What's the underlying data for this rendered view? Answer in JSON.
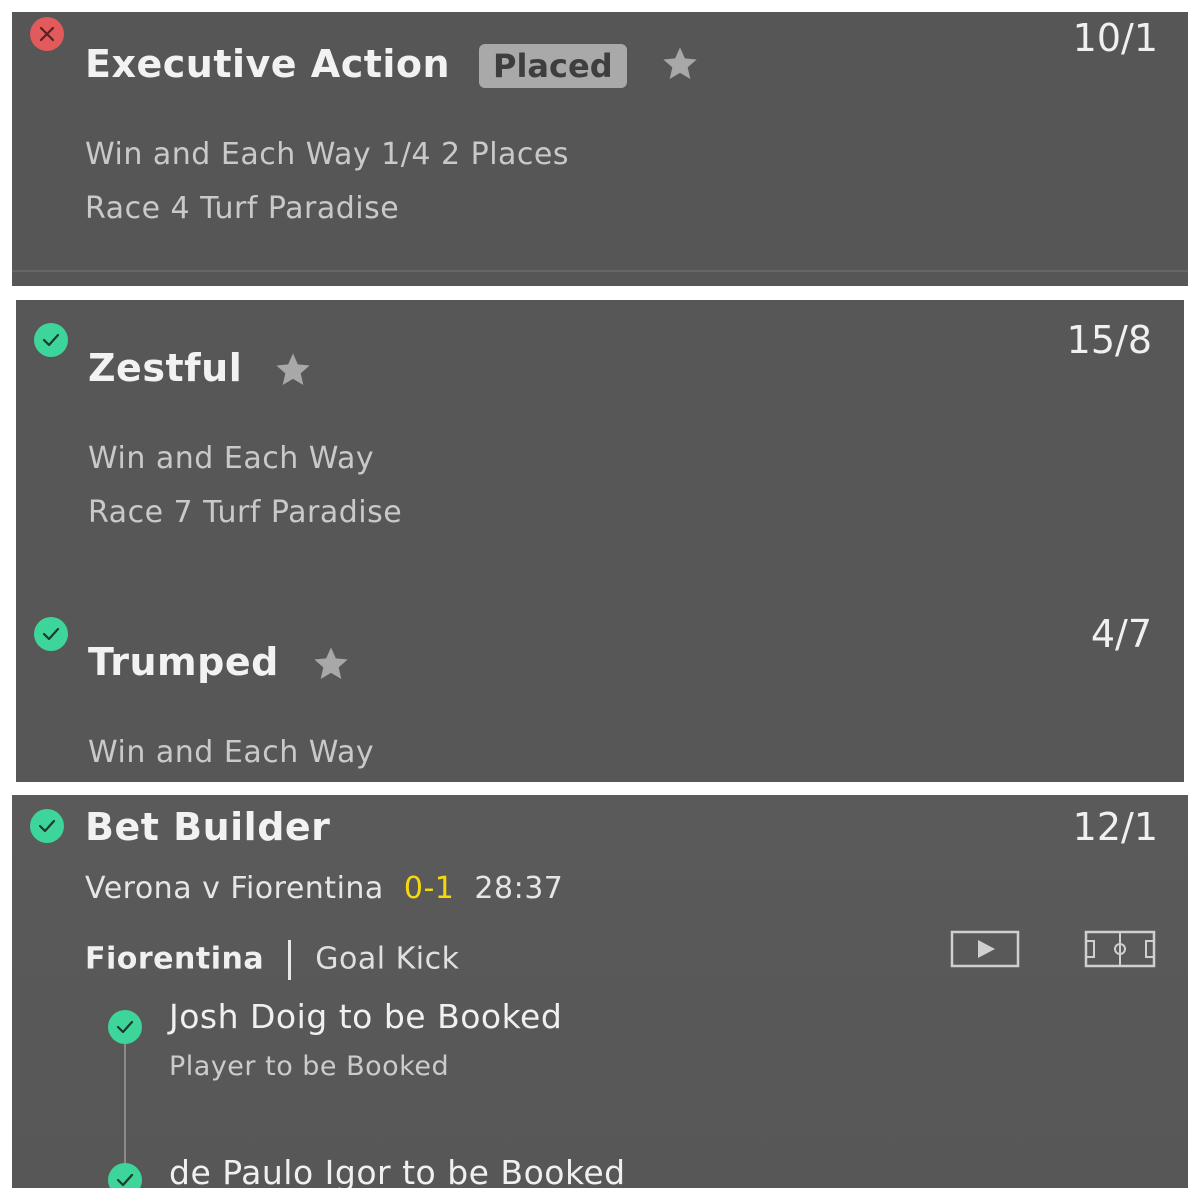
{
  "bets": [
    {
      "status": "lost",
      "selection": "Executive Action",
      "badge": "Placed",
      "odds": "10/1",
      "market": "Win and Each Way 1/4 2 Places",
      "event": "Race 4 Turf Paradise"
    },
    {
      "status": "won",
      "selection": "Zestful",
      "odds": "15/8",
      "market": "Win and Each Way",
      "event": "Race 7 Turf Paradise"
    },
    {
      "status": "won",
      "selection": "Trumped",
      "odds": "4/7",
      "market": "Win and Each Way"
    }
  ],
  "bet_builder": {
    "status": "won",
    "title": "Bet Builder",
    "odds": "12/1",
    "match": "Verona v Fiorentina",
    "score": "0-1",
    "clock": "28:37",
    "live_team": "Fiorentina",
    "live_event": "Goal Kick",
    "legs": [
      {
        "title": "Josh Doig to be Booked",
        "market": "Player to be Booked",
        "status": "won"
      },
      {
        "title": "de Paulo Igor to be Booked",
        "status": "won"
      }
    ]
  },
  "colors": {
    "panel_bg": "#565656",
    "win_green": "#3ed59a",
    "lose_red": "#e15a5c",
    "score_yellow": "#f5d90a",
    "badge_bg": "#a9a9a9"
  },
  "icons": {
    "lost": "close-icon",
    "won": "check-icon",
    "favourite": "star-icon",
    "stream": "play-icon",
    "pitch": "pitch-icon"
  }
}
